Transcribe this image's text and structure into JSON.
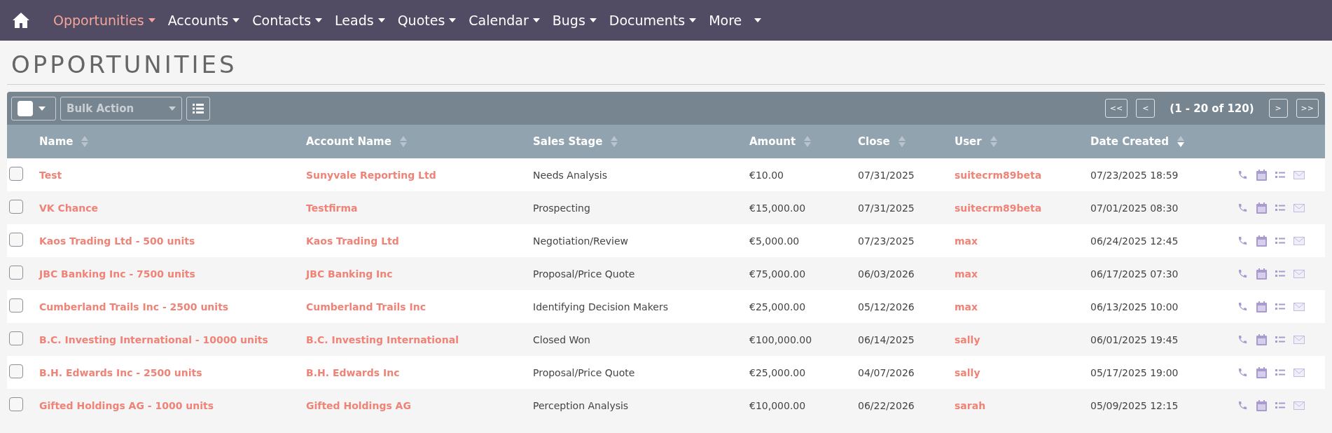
{
  "nav": {
    "items": [
      {
        "label": "Opportunities",
        "selected": true
      },
      {
        "label": "Accounts",
        "selected": false
      },
      {
        "label": "Contacts",
        "selected": false
      },
      {
        "label": "Leads",
        "selected": false
      },
      {
        "label": "Quotes",
        "selected": false
      },
      {
        "label": "Calendar",
        "selected": false
      },
      {
        "label": "Bugs",
        "selected": false
      },
      {
        "label": "Documents",
        "selected": false
      },
      {
        "label": "More",
        "selected": false
      }
    ]
  },
  "page_title": "OPPORTUNITIES",
  "toolbar": {
    "bulk_action": "Bulk Action",
    "pagination": {
      "first": "<<",
      "prev": "<",
      "range": "(1 - 20 of 120)",
      "next": ">",
      "last": ">>"
    }
  },
  "table": {
    "columns": [
      {
        "label": "Name",
        "sorted": false
      },
      {
        "label": "Account Name",
        "sorted": false
      },
      {
        "label": "Sales Stage",
        "sorted": false
      },
      {
        "label": "Amount",
        "sorted": false
      },
      {
        "label": "Close",
        "sorted": false
      },
      {
        "label": "User",
        "sorted": false
      },
      {
        "label": "Date Created",
        "sorted": true
      }
    ],
    "rows": [
      {
        "checked": false,
        "name": "Test",
        "account": "Sunyvale Reporting Ltd",
        "stage": "Needs Analysis",
        "amount": "€10.00",
        "close": "07/31/2025",
        "user": "suitecrm89beta",
        "created": "07/23/2025 18:59"
      },
      {
        "checked": false,
        "name": "VK Chance",
        "account": "Testfirma",
        "stage": "Prospecting",
        "amount": "€15,000.00",
        "close": "07/31/2025",
        "user": "suitecrm89beta",
        "created": "07/01/2025 08:30"
      },
      {
        "checked": false,
        "name": "Kaos Trading Ltd - 500 units",
        "account": "Kaos Trading Ltd",
        "stage": "Negotiation/Review",
        "amount": "€5,000.00",
        "close": "07/23/2025",
        "user": "max",
        "created": "06/24/2025 12:45"
      },
      {
        "checked": false,
        "name": "JBC Banking Inc - 7500 units",
        "account": "JBC Banking Inc",
        "stage": "Proposal/Price Quote",
        "amount": "€75,000.00",
        "close": "06/03/2026",
        "user": "max",
        "created": "06/17/2025 07:30"
      },
      {
        "checked": false,
        "name": "Cumberland Trails Inc - 2500 units",
        "account": "Cumberland Trails Inc",
        "stage": "Identifying Decision Makers",
        "amount": "€25,000.00",
        "close": "05/12/2026",
        "user": "max",
        "created": "06/13/2025 10:00"
      },
      {
        "checked": false,
        "name": "B.C. Investing International - 10000 units",
        "account": "B.C. Investing International",
        "stage": "Closed Won",
        "amount": "€100,000.00",
        "close": "06/14/2025",
        "user": "sally",
        "created": "06/01/2025 19:45"
      },
      {
        "checked": false,
        "name": "B.H. Edwards Inc - 2500 units",
        "account": "B.H. Edwards Inc",
        "stage": "Proposal/Price Quote",
        "amount": "€25,000.00",
        "close": "04/07/2026",
        "user": "sally",
        "created": "05/17/2025 19:00"
      },
      {
        "checked": false,
        "name": "Gifted Holdings AG - 1000 units",
        "account": "Gifted Holdings AG",
        "stage": "Perception Analysis",
        "amount": "€10,000.00",
        "close": "06/22/2026",
        "user": "sarah",
        "created": "05/09/2025 12:15"
      }
    ]
  }
}
